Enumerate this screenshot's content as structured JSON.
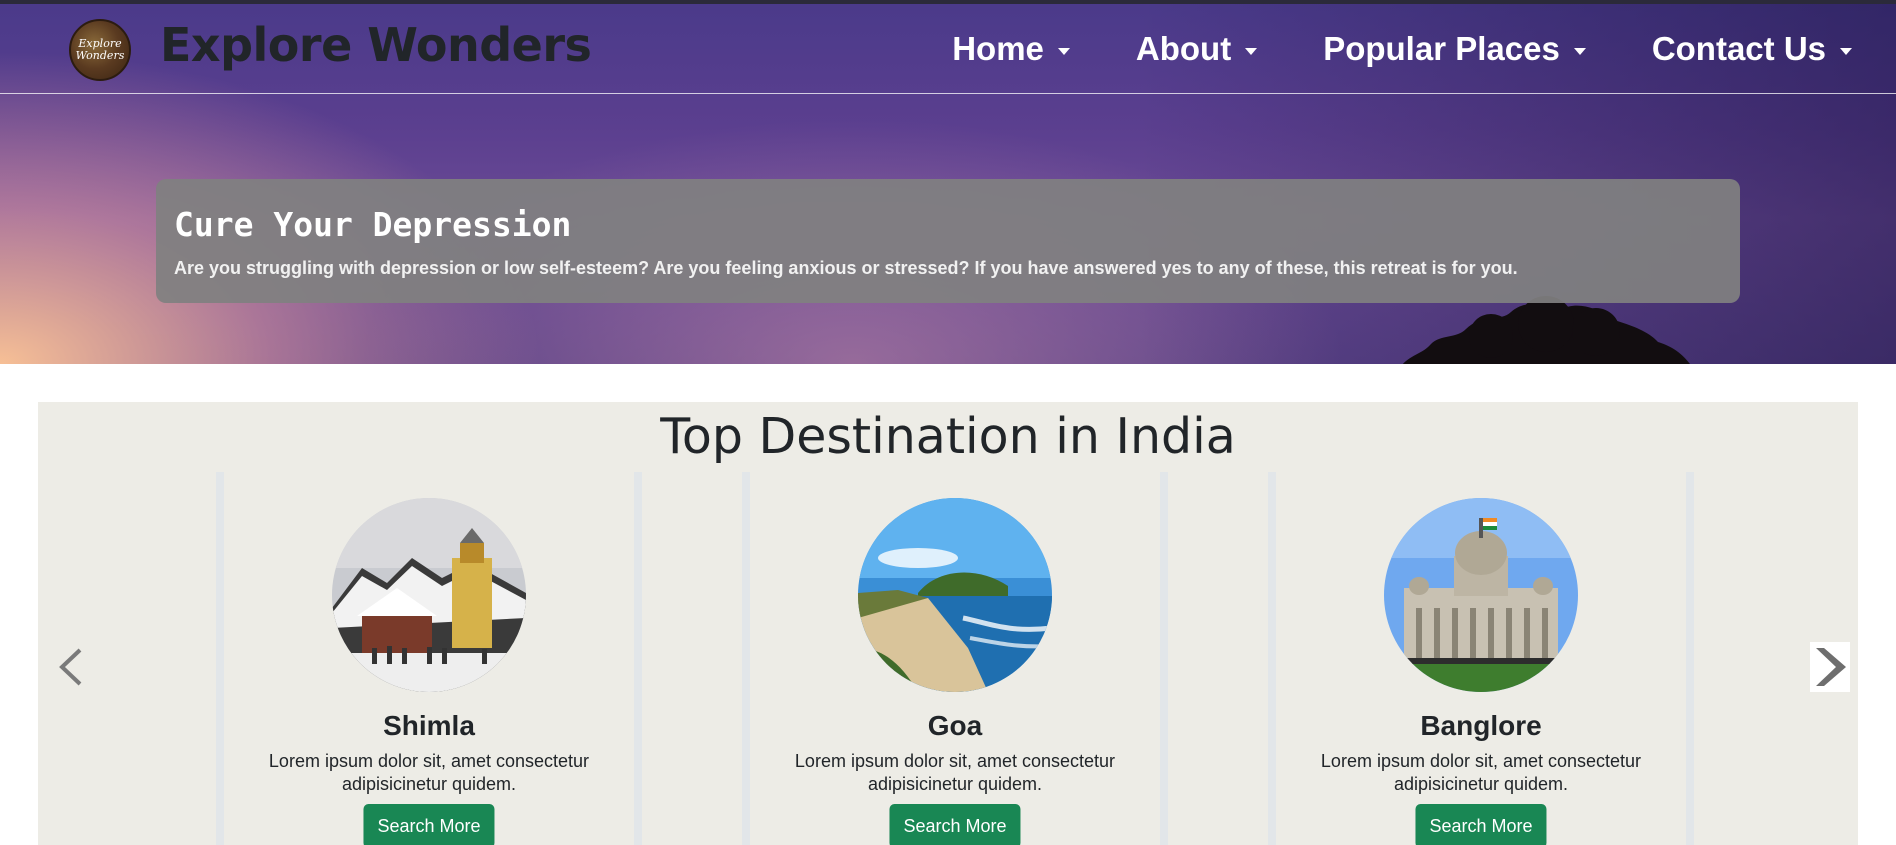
{
  "brand": {
    "name": "Explore Wonders",
    "logo_text": "Explore Wonders"
  },
  "nav": {
    "items": [
      {
        "label": "Home"
      },
      {
        "label": "About"
      },
      {
        "label": "Popular Places"
      },
      {
        "label": "Contact Us"
      }
    ]
  },
  "hero": {
    "title": "Cure Your Depression",
    "text": "Are you struggling with depression or low self-esteem? Are you feeling anxious or stressed? If you have answered yes to any of these, this retreat is for you."
  },
  "destinations": {
    "title": "Top Destination in India",
    "cards": [
      {
        "name": "Shimla",
        "description": "Lorem ipsum dolor sit, amet consectetur adipisicinetur quidem.",
        "button": "Search More"
      },
      {
        "name": "Goa",
        "description": "Lorem ipsum dolor sit, amet consectetur adipisicinetur quidem.",
        "button": "Search More"
      },
      {
        "name": "Banglore",
        "description": "Lorem ipsum dolor sit, amet consectetur adipisicinetur quidem.",
        "button": "Search More"
      }
    ]
  },
  "colors": {
    "button": "#198754",
    "section_bg": "#edece6",
    "text_dark": "#212529"
  },
  "icons": {
    "prev": "chevron-left-icon",
    "next": "chevron-right-icon",
    "dropdown": "caret-down-icon"
  }
}
